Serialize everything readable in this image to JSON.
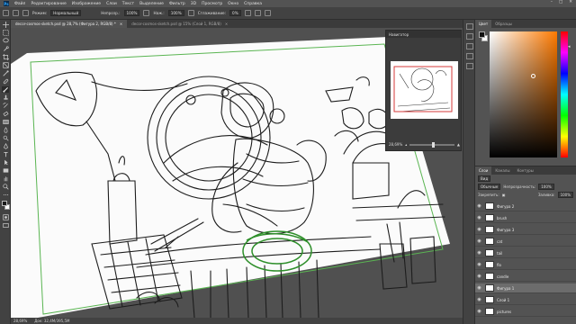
{
  "menu": {
    "items": [
      "Файл",
      "Редактирование",
      "Изображение",
      "Слои",
      "Текст",
      "Выделение",
      "Фильтр",
      "3D",
      "Просмотр",
      "Окно",
      "Справка"
    ]
  },
  "options": {
    "mode_label": "Режим:",
    "mode_value": "Нормальный",
    "opacity_label": "Непрозр.:",
    "opacity_value": "100%",
    "flow_label": "Наж.:",
    "flow_value": "100%",
    "smoothing_label": "Сглаживание:",
    "smoothing_value": "0%"
  },
  "tabs": [
    {
      "label": "decor-cosmos-sketch.psd @ 28,7% (Фигура 2, RGB/8) *",
      "close": "×"
    },
    {
      "label": "decor-cosmos-sketch.psd @ 15% (Слой 1, RGB/8)",
      "close": "×"
    }
  ],
  "statusbar": {
    "zoom": "28,69%",
    "doc": "Док: 32,4М/395,5М"
  },
  "navigator": {
    "title": "Навигатор",
    "zoom": "28,69%"
  },
  "panels": {
    "color_tabs": [
      "Цвет",
      "Образцы"
    ],
    "layers_tabs": [
      "Слои",
      "Каналы",
      "Контуры"
    ],
    "kind_filter": "Вид",
    "blend_mode": "Обычные",
    "opacity_label": "Непрозрачность:",
    "opacity_value": "100%",
    "lock_label": "Закрепить:",
    "fill_label": "Заливка:",
    "fill_value": "100%"
  },
  "layers": [
    {
      "name": "Фигура 2",
      "visible": true,
      "selected": false
    },
    {
      "name": "brush",
      "visible": true,
      "selected": false
    },
    {
      "name": "Фигура 3",
      "visible": true,
      "selected": false
    },
    {
      "name": "cat",
      "visible": true,
      "selected": false
    },
    {
      "name": "tail",
      "visible": true,
      "selected": false
    },
    {
      "name": "flo",
      "visible": true,
      "selected": false
    },
    {
      "name": "candle",
      "visible": true,
      "selected": false
    },
    {
      "name": "Фигура 1",
      "visible": true,
      "selected": true
    },
    {
      "name": "Слой 1",
      "visible": true,
      "selected": false
    },
    {
      "name": "pictures",
      "visible": true,
      "selected": false
    }
  ],
  "tooltip": "Фигура 1",
  "colors": {
    "accent_green": "#5ab552",
    "selection": "#6c6c6c"
  }
}
